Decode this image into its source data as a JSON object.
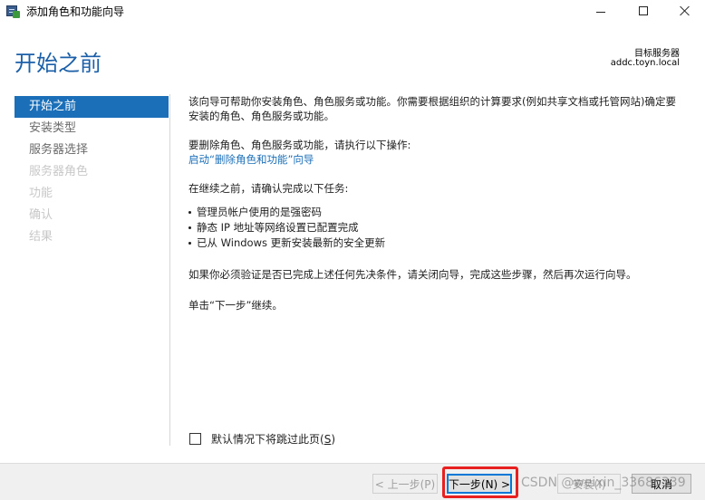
{
  "window": {
    "title": "添加角色和功能向导",
    "icon": "server-manager-icon"
  },
  "header": {
    "page_title": "开始之前",
    "target_label": "目标服务器",
    "target_server": "addc.toyn.local"
  },
  "nav": {
    "items": [
      {
        "label": "开始之前",
        "state": "active"
      },
      {
        "label": "安装类型",
        "state": "enabled"
      },
      {
        "label": "服务器选择",
        "state": "enabled"
      },
      {
        "label": "服务器角色",
        "state": "disabled"
      },
      {
        "label": "功能",
        "state": "disabled"
      },
      {
        "label": "确认",
        "state": "disabled"
      },
      {
        "label": "结果",
        "state": "disabled"
      }
    ]
  },
  "content": {
    "intro": "该向导可帮助你安装角色、角色服务或功能。你需要根据组织的计算要求(例如共享文档或托管网站)确定要安装的角色、角色服务或功能。",
    "remove_text": "要删除角色、角色服务或功能，请执行以下操作:",
    "remove_link": "启动“删除角色和功能”向导",
    "before_text": "在继续之前，请确认完成以下任务:",
    "tasks": [
      "管理员帐户使用的是强密码",
      "静态 IP 地址等网络设置已配置完成",
      "已从 Windows 更新安装最新的安全更新"
    ],
    "verify_text": "如果你必须验证是否已完成上述任何先决条件，请关闭向导，完成这些步骤，然后再次运行向导。",
    "click_next": "单击“下一步”继续。"
  },
  "skip": {
    "label_prefix": "默认情况下将跳过此页(",
    "label_key": "S",
    "label_suffix": ")",
    "checked": false
  },
  "footer": {
    "prev_label": "< 上一步(P)",
    "next_label": "下一步(N) >",
    "install_label": "安装(I)",
    "cancel_label": "取消"
  },
  "watermark": "CSDN @weixin_33686339",
  "colors": {
    "accent": "#1a6fb8",
    "highlight": "#e8201f"
  }
}
